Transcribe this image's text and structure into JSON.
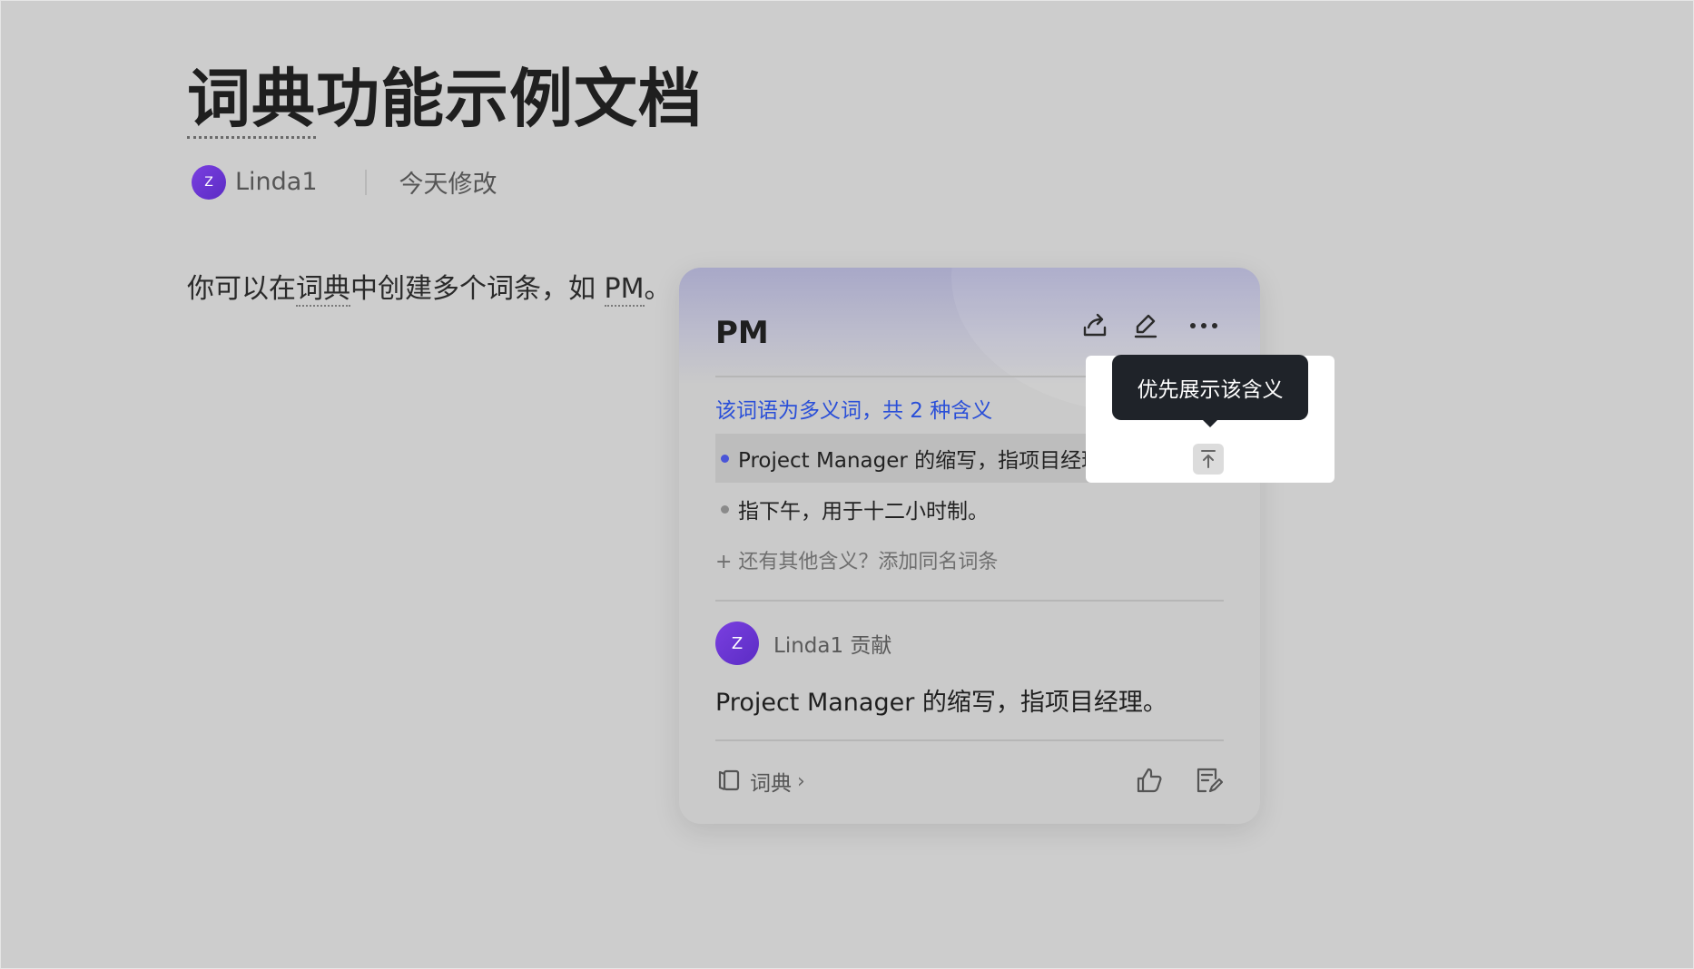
{
  "document": {
    "title_prefix": "词典",
    "title_rest": "功能示例文档",
    "author_avatar": "Z",
    "author": "Linda1",
    "modified": "今天修改",
    "body_pre": "你可以在",
    "body_term1": "词典",
    "body_mid": "中创建多个词条，如 ",
    "body_term2": "PM",
    "body_post": "。"
  },
  "card": {
    "term": "PM",
    "header_icons": [
      "share-icon",
      "edit-icon",
      "more-icon"
    ],
    "polysemy_note": "该词语为多义词，共 2 种含义",
    "meanings": [
      {
        "text": "Project Manager 的缩写，指项目经理。",
        "active": true,
        "dot_color": "#4a55d8"
      },
      {
        "text": "指下午，用于十二小时制。",
        "active": false,
        "dot_color": "#8a8a8a"
      }
    ],
    "add_synonym": "+ 还有其他含义？添加同名词条",
    "contributor_avatar": "Z",
    "contributor": "Linda1 贡献",
    "definition": "Project Manager 的缩写，指项目经理。",
    "footer_link": "词典",
    "footer_chevron": "›",
    "footer_icons": [
      "thumbs-up-icon",
      "feedback-icon"
    ]
  },
  "tooltip": {
    "text": "优先展示该含义"
  },
  "colors": {
    "accent_link": "#2a4fd8",
    "avatar": "#6a35d4",
    "tooltip_bg": "#1f2329"
  }
}
